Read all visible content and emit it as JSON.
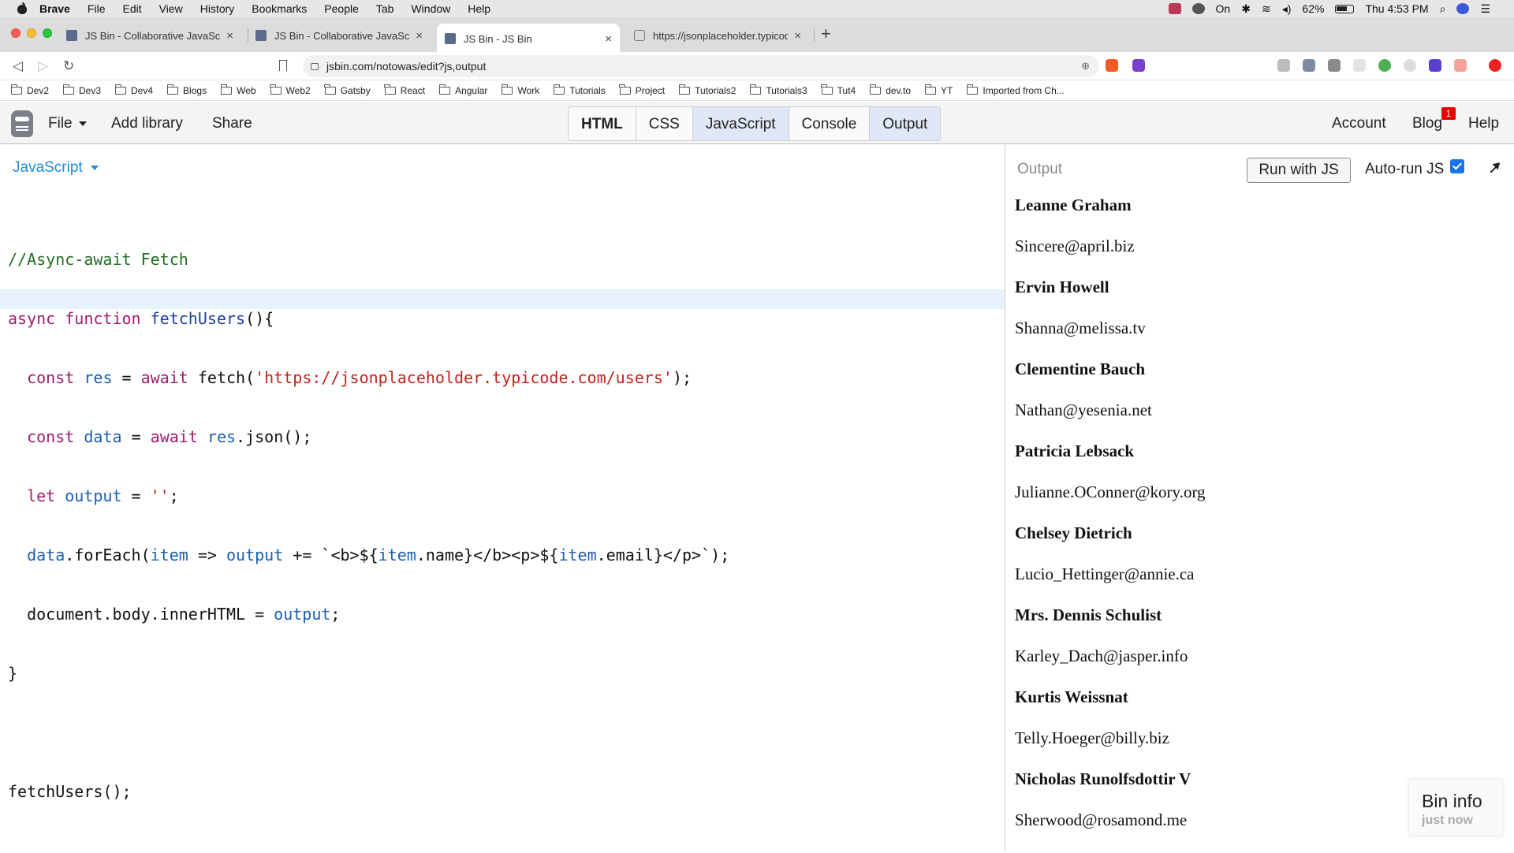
{
  "menubar": {
    "items": [
      "Brave",
      "File",
      "Edit",
      "View",
      "History",
      "Bookmarks",
      "People",
      "Tab",
      "Window",
      "Help"
    ],
    "on_label": "On",
    "battery": "62%",
    "clock": "Thu 4:53 PM"
  },
  "tabs": [
    {
      "label": "JS Bin - Collaborative JavaScript",
      "close": "×"
    },
    {
      "label": "JS Bin - Collaborative JavaScript",
      "close": "×"
    },
    {
      "label": "JS Bin - JS Bin",
      "close": "×"
    },
    {
      "label": "https://jsonplaceholder.typicode",
      "close": "×"
    }
  ],
  "new_tab": "+",
  "address": {
    "url": "jsbin.com/notowas/edit?js,output"
  },
  "bookmarks": [
    "Dev2",
    "Dev3",
    "Dev4",
    "Blogs",
    "Web",
    "Web2",
    "Gatsby",
    "React",
    "Angular",
    "Work",
    "Tutorials",
    "Project",
    "Tutorials2",
    "Tutorials3",
    "Tut4",
    "dev.to",
    "YT",
    "Imported from Ch..."
  ],
  "toolbar": {
    "file": "File",
    "add_library": "Add library",
    "share": "Share",
    "panels": [
      "HTML",
      "CSS",
      "JavaScript",
      "Console",
      "Output"
    ],
    "account": "Account",
    "blog": "Blog",
    "blog_badge": "1",
    "help": "Help"
  },
  "editor": {
    "language": "JavaScript"
  },
  "output": {
    "label": "Output",
    "run_button": "Run with JS",
    "autorun_label": "Auto-run JS",
    "users": [
      {
        "name": "Leanne Graham",
        "email": "Sincere@april.biz"
      },
      {
        "name": "Ervin Howell",
        "email": "Shanna@melissa.tv"
      },
      {
        "name": "Clementine Bauch",
        "email": "Nathan@yesenia.net"
      },
      {
        "name": "Patricia Lebsack",
        "email": "Julianne.OConner@kory.org"
      },
      {
        "name": "Chelsey Dietrich",
        "email": "Lucio_Hettinger@annie.ca"
      },
      {
        "name": "Mrs. Dennis Schulist",
        "email": "Karley_Dach@jasper.info"
      },
      {
        "name": "Kurtis Weissnat",
        "email": "Telly.Hoeger@billy.biz"
      },
      {
        "name": "Nicholas Runolfsdottir V",
        "email": "Sherwood@rosamond.me"
      }
    ],
    "bin_info_title": "Bin info",
    "bin_info_sub": "just now"
  },
  "colors": {
    "panel_active": "#dfe8f6",
    "link_blue": "#1a8fd6",
    "badge_red": "#e60000"
  }
}
